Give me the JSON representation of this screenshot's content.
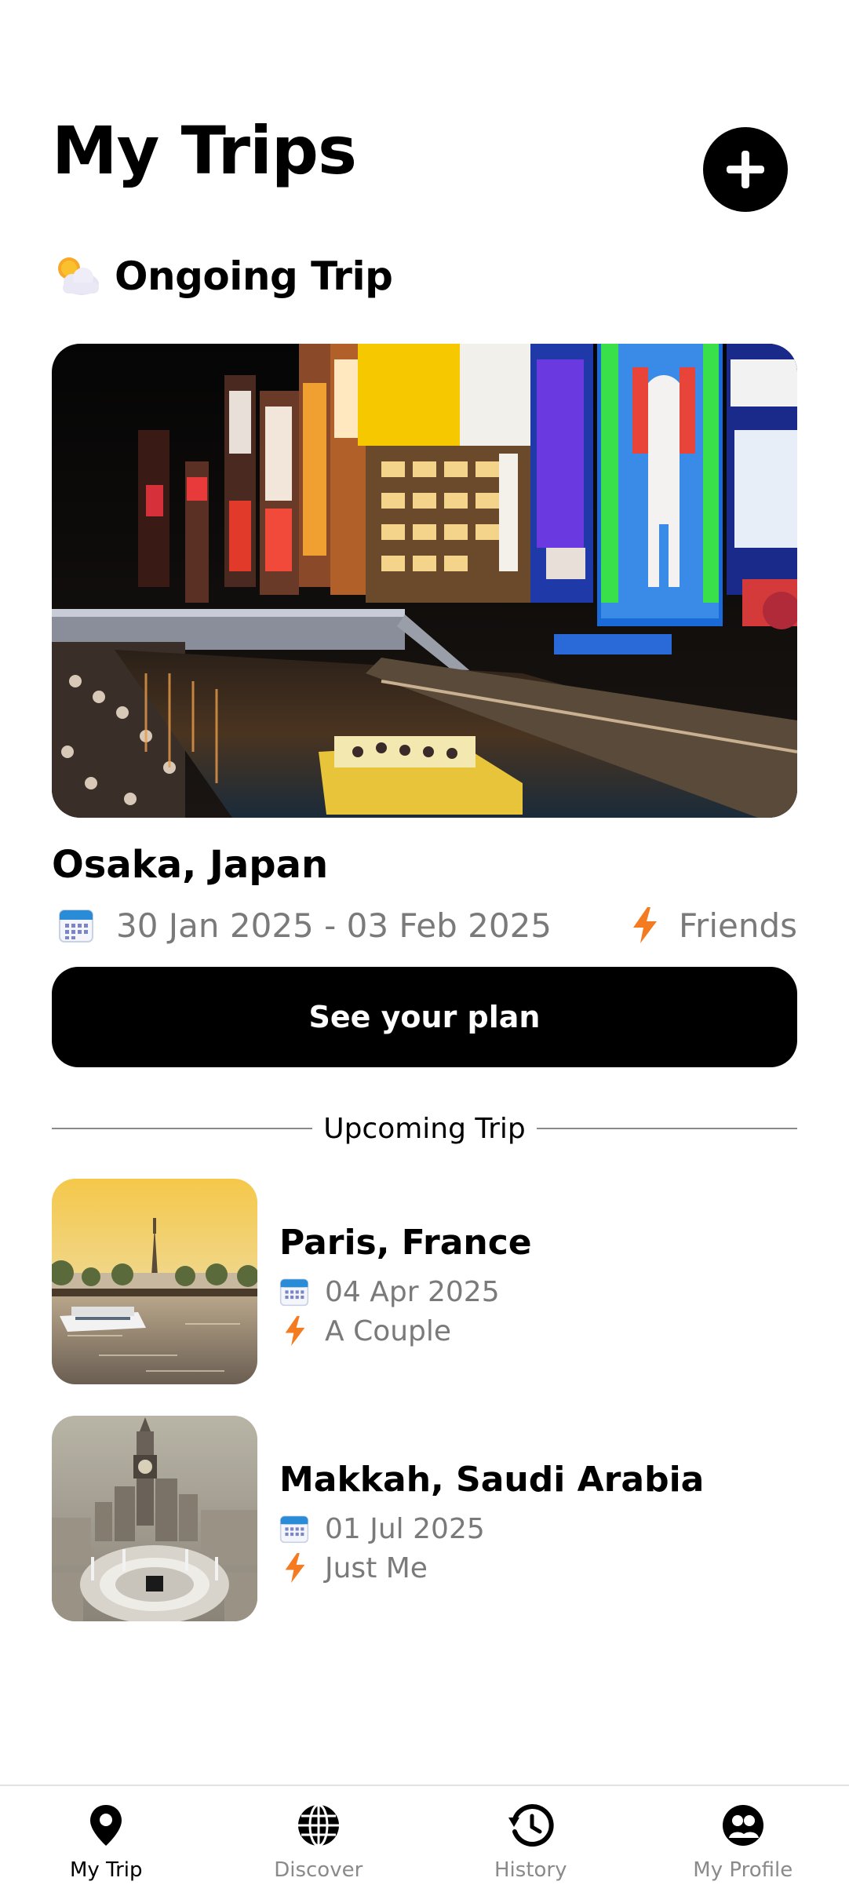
{
  "header": {
    "title": "My Trips",
    "add_icon": "plus-icon"
  },
  "ongoing": {
    "heading": "Ongoing Trip",
    "heading_icon": "sun-behind-cloud-icon",
    "destination": "Osaka, Japan",
    "dates": "30 Jan 2025 - 03 Feb 2025",
    "companions": "Friends",
    "button_label": "See your plan"
  },
  "upcoming": {
    "heading": "Upcoming Trip",
    "trips": [
      {
        "destination": "Paris, France",
        "date": "04 Apr 2025",
        "companions": "A Couple"
      },
      {
        "destination": "Makkah, Saudi Arabia",
        "date": "01 Jul 2025",
        "companions": "Just Me"
      }
    ]
  },
  "nav": {
    "items": [
      {
        "label": "My Trip",
        "icon": "map-pin-icon",
        "active": true
      },
      {
        "label": "Discover",
        "icon": "globe-icon",
        "active": false
      },
      {
        "label": "History",
        "icon": "history-icon",
        "active": false
      },
      {
        "label": "My Profile",
        "icon": "profile-icon",
        "active": false
      }
    ]
  },
  "colors": {
    "accent_bolt": "#f47b20",
    "calendar_blue": "#2a8cd6",
    "muted_text": "#7a7a7a",
    "button_bg": "#000000"
  }
}
